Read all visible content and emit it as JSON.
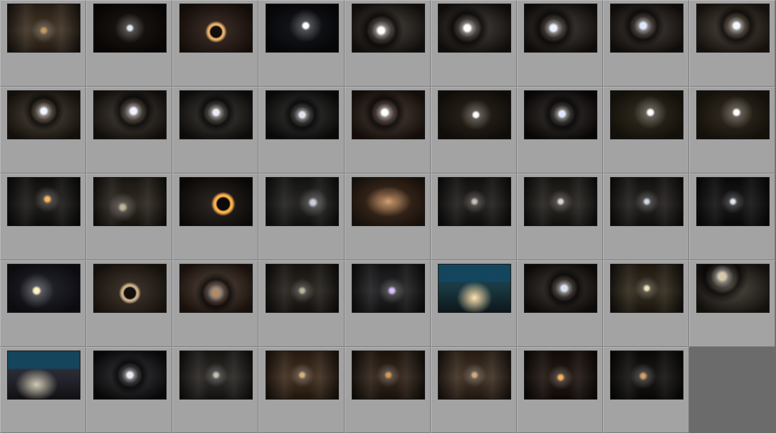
{
  "grid": {
    "columns": 9,
    "rows": 5,
    "thumbnail_style": "tunnel",
    "thumbnails": [
      {
        "base": "#3a2c1d",
        "light": "#c79a5e",
        "shape": "corridor",
        "mx": 0.5,
        "my": 0.55
      },
      {
        "base": "#120c08",
        "light": "#e2e8f2",
        "shape": "point",
        "mx": 0.5,
        "my": 0.5
      },
      {
        "base": "#2a1a12",
        "light": "#e8b06a",
        "shape": "ring",
        "mx": 0.5,
        "my": 0.58
      },
      {
        "base": "#0c0d12",
        "light": "#ffffff",
        "shape": "point",
        "mx": 0.55,
        "my": 0.45
      },
      {
        "base": "#241d17",
        "light": "#ffffff",
        "shape": "hole",
        "mx": 0.4,
        "my": 0.55
      },
      {
        "base": "#221b16",
        "light": "#ffffff",
        "shape": "hole",
        "mx": 0.4,
        "my": 0.5
      },
      {
        "base": "#1f1813",
        "light": "#eef2ff",
        "shape": "hole",
        "mx": 0.4,
        "my": 0.5
      },
      {
        "base": "#221a14",
        "light": "#dfe8ff",
        "shape": "hole",
        "mx": 0.45,
        "my": 0.45
      },
      {
        "base": "#2e241a",
        "light": "#f4f7ff",
        "shape": "hole",
        "mx": 0.55,
        "my": 0.45
      },
      {
        "base": "#2d2217",
        "light": "#f2f4ff",
        "shape": "hole",
        "mx": 0.5,
        "my": 0.42
      },
      {
        "base": "#251d16",
        "light": "#f0f3ff",
        "shape": "hole",
        "mx": 0.55,
        "my": 0.42
      },
      {
        "base": "#1c1814",
        "light": "#e9eef5",
        "shape": "hole",
        "mx": 0.5,
        "my": 0.45
      },
      {
        "base": "#121110",
        "light": "#dfe4ee",
        "shape": "hole",
        "mx": 0.5,
        "my": 0.5
      },
      {
        "base": "#2a1a12",
        "light": "#ffffff",
        "shape": "hole",
        "mx": 0.45,
        "my": 0.45
      },
      {
        "base": "#241c13",
        "light": "#ffffff",
        "shape": "point",
        "mx": 0.52,
        "my": 0.5
      },
      {
        "base": "#120d0a",
        "light": "#dfe8ff",
        "shape": "hole",
        "mx": 0.52,
        "my": 0.48
      },
      {
        "base": "#2a2416",
        "light": "#ffffff",
        "shape": "point",
        "mx": 0.55,
        "my": 0.45
      },
      {
        "base": "#2c2317",
        "light": "#ffffff",
        "shape": "point",
        "mx": 0.55,
        "my": 0.45
      },
      {
        "base": "#151411",
        "light": "#ffb85a",
        "shape": "corridor",
        "mx": 0.55,
        "my": 0.45
      },
      {
        "base": "#262018",
        "light": "#bfb39a",
        "shape": "corridor",
        "mx": 0.4,
        "my": 0.62
      },
      {
        "base": "#15100c",
        "light": "#ffb24d",
        "shape": "ring",
        "mx": 0.6,
        "my": 0.55
      },
      {
        "base": "#1c1b1a",
        "light": "#c9cfda",
        "shape": "corridor",
        "mx": 0.65,
        "my": 0.52
      },
      {
        "base": "#3d2a1c",
        "light": "#d7a173",
        "shape": "cave",
        "mx": 0.5,
        "my": 0.5
      },
      {
        "base": "#1a1715",
        "light": "#c4c0b2",
        "shape": "corridor",
        "mx": 0.5,
        "my": 0.5
      },
      {
        "base": "#1f1c18",
        "light": "#d9d6cc",
        "shape": "corridor",
        "mx": 0.5,
        "my": 0.5
      },
      {
        "base": "#1b1816",
        "light": "#cfd8e6",
        "shape": "corridor",
        "mx": 0.5,
        "my": 0.5
      },
      {
        "base": "#0e0d0d",
        "light": "#dfe7f3",
        "shape": "corridor",
        "mx": 0.5,
        "my": 0.5
      },
      {
        "base": "#1a1a24",
        "light": "#fff3c4",
        "shape": "point",
        "mx": 0.4,
        "my": 0.55
      },
      {
        "base": "#2e2219",
        "light": "#c9b089",
        "shape": "ring",
        "mx": 0.5,
        "my": 0.6
      },
      {
        "base": "#362318",
        "light": "#b88a5e",
        "shape": "hole",
        "mx": 0.5,
        "my": 0.6
      },
      {
        "base": "#1f1b16",
        "light": "#b6b49a",
        "shape": "corridor",
        "mx": 0.5,
        "my": 0.55
      },
      {
        "base": "#1b1a1c",
        "light": "#d8c3ff",
        "shape": "corridor",
        "mx": 0.55,
        "my": 0.55
      },
      {
        "base": "#1b3a44",
        "light": "#ffe2b0",
        "shape": "scene",
        "mx": 0.5,
        "my": 0.55
      },
      {
        "base": "#1b1410",
        "light": "#d9e1ef",
        "shape": "hole",
        "mx": 0.55,
        "my": 0.5
      },
      {
        "base": "#2c2416",
        "light": "#efe3b8",
        "shape": "corridor",
        "mx": 0.5,
        "my": 0.5
      },
      {
        "base": "#2a241b",
        "light": "#d7c8aa",
        "shape": "hole",
        "mx": 0.35,
        "my": 0.25
      },
      {
        "base": "#2a2a33",
        "light": "#cfc9b4",
        "shape": "scene",
        "mx": 0.4,
        "my": 0.55
      },
      {
        "base": "#100f12",
        "light": "#e8ecf5",
        "shape": "hole",
        "mx": 0.5,
        "my": 0.5
      },
      {
        "base": "#23201d",
        "light": "#c3c0b3",
        "shape": "corridor",
        "mx": 0.5,
        "my": 0.5
      },
      {
        "base": "#3a2717",
        "light": "#d8b07e",
        "shape": "corridor",
        "mx": 0.5,
        "my": 0.5
      },
      {
        "base": "#2b1d12",
        "light": "#d59a55",
        "shape": "corridor",
        "mx": 0.5,
        "my": 0.5
      },
      {
        "base": "#3a2a1c",
        "light": "#d2ab7b",
        "shape": "corridor",
        "mx": 0.5,
        "my": 0.5
      },
      {
        "base": "#1a0f0a",
        "light": "#ffb25a",
        "shape": "corridor",
        "mx": 0.5,
        "my": 0.55
      },
      {
        "base": "#0e0c0a",
        "light": "#d6a066",
        "shape": "corridor",
        "mx": 0.45,
        "my": 0.52
      },
      null
    ]
  }
}
